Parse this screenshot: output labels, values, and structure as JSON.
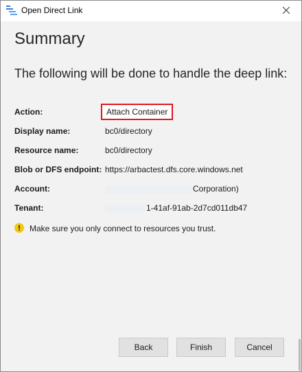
{
  "window": {
    "title": "Open Direct Link"
  },
  "summary": {
    "heading": "Summary",
    "subheading": "The following will be done to handle the deep link:"
  },
  "details": [
    {
      "label": "Action:",
      "value": "Attach Container"
    },
    {
      "label": "Display name:",
      "value": "bc0/directory"
    },
    {
      "label": "Resource name:",
      "value": "bc0/directory"
    },
    {
      "label": "Blob or DFS endpoint:",
      "value": "https://arbactest.dfs.core.windows.net"
    },
    {
      "label": "Account:",
      "value": "Corporation)"
    },
    {
      "label": "Tenant:",
      "value": "1-41af-91ab-2d7cd011db47"
    }
  ],
  "warning": {
    "text": "Make sure you only connect to resources you trust."
  },
  "buttons": {
    "back": "Back",
    "finish": "Finish",
    "cancel": "Cancel"
  },
  "colors": {
    "highlight_border": "#e0141e",
    "warning_icon": "#f2c811",
    "dialog_background": "#f2f2f2"
  }
}
